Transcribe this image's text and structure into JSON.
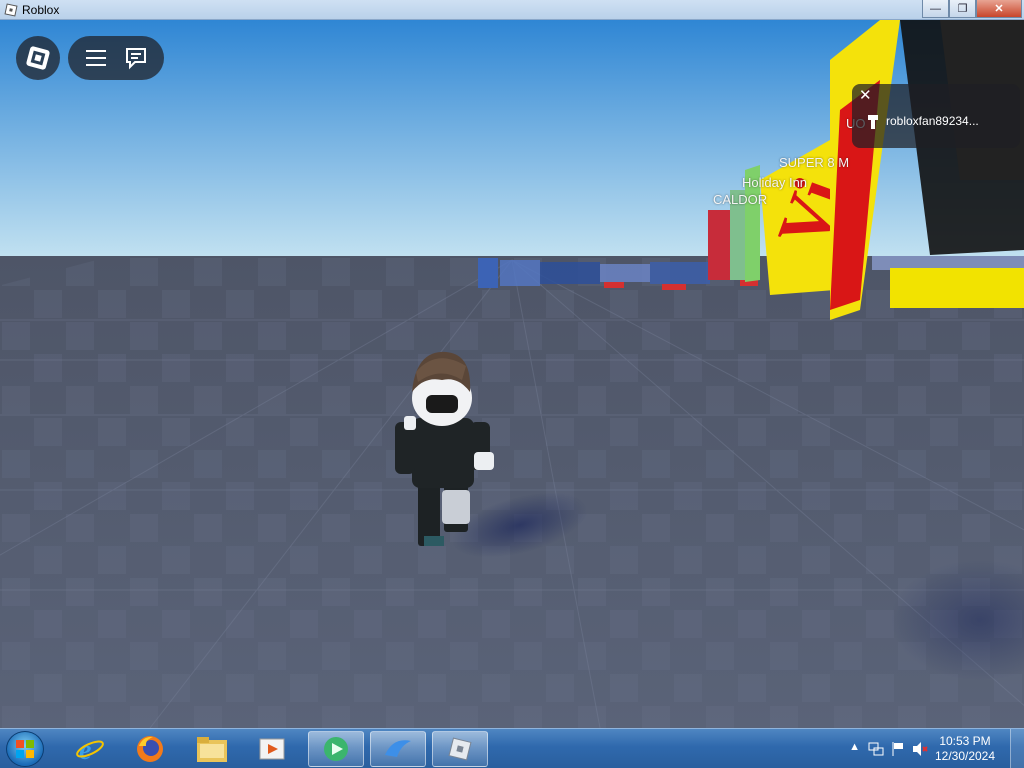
{
  "window": {
    "title": "Roblox",
    "controls": {
      "minimize": "—",
      "maximize": "❐",
      "close": "✕"
    }
  },
  "hud": {
    "menu_icon": "menu-icon",
    "chat_icon": "chat-icon"
  },
  "player_list": {
    "close": "✕",
    "username": "robloxfan89234..."
  },
  "world_labels": {
    "caldor": "CALDOR",
    "holiday_inn": "Holiday Inn",
    "super8": "SUPER 8 M",
    "partial": "UO"
  },
  "taskbar": {
    "pinned": [
      "internet-explorer-icon",
      "firefox-icon",
      "file-explorer-icon",
      "media-player-icon"
    ],
    "running": [
      "green-app-icon",
      "blue-app-icon",
      "roblox-icon"
    ],
    "clock": {
      "time": "10:53 PM",
      "date": "12/30/2024"
    }
  },
  "colors": {
    "sky_top": "#2f86d4",
    "sky_bottom": "#b9dbee",
    "ground": "#545c70",
    "taskbar": "#2f69ad"
  }
}
